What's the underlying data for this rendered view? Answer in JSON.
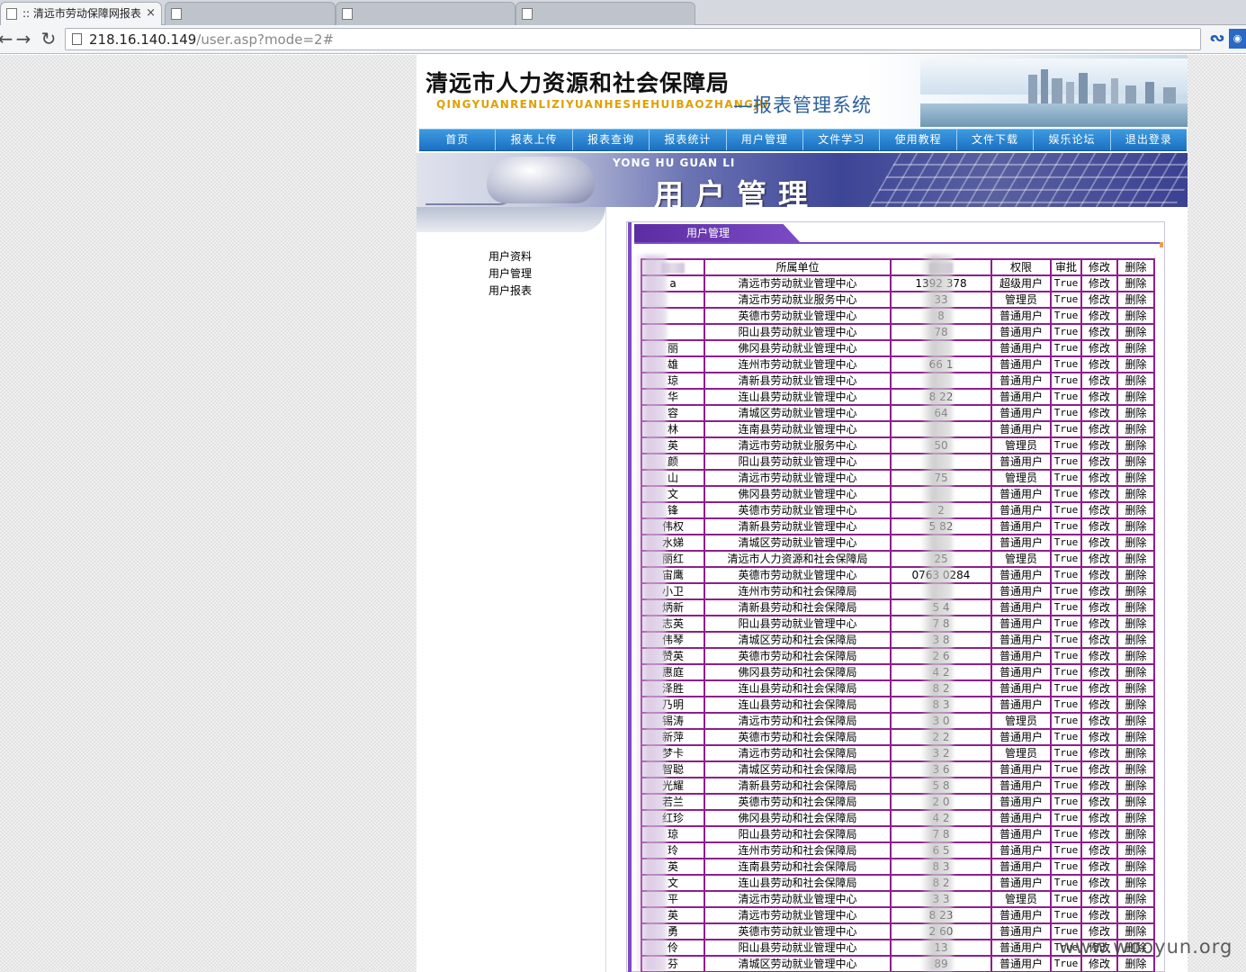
{
  "browser": {
    "tabs": [
      {
        "label": ":: 清远市劳动保障网报表"
      },
      {
        "label": ""
      },
      {
        "label": ""
      },
      {
        "label": ""
      }
    ],
    "url_host": "218.16.140.149",
    "url_path": "/user.asp?mode=2#"
  },
  "site": {
    "title": "清远市人力资源和社会保障局",
    "pinyin": "QINGYUANRENLIZIYUANHESHEHUIBAOZHANGJU",
    "subtitle": "—报表管理系统",
    "nav": [
      "首页",
      "报表上传",
      "报表查询",
      "报表统计",
      "用户管理",
      "文件学习",
      "使用教程",
      "文件下载",
      "娱乐论坛",
      "退出登录"
    ],
    "banner_pinyin": "YONG HU GUAN LI",
    "banner_title": "用户管理"
  },
  "sidebar": {
    "items": [
      "用户资料",
      "用户管理",
      "用户报表"
    ]
  },
  "panel": {
    "tab_label": "用户管理"
  },
  "table": {
    "headers": [
      "",
      "所属单位",
      "",
      "权限",
      "审批",
      "修改",
      "删除"
    ],
    "rows": [
      [
        "a",
        "清远市劳动就业管理中心",
        "1392 378",
        "超级用户",
        "True",
        "修改",
        "删除"
      ],
      [
        "",
        "清远市劳动就业服务中心",
        "33",
        "管理员",
        "True",
        "修改",
        "删除"
      ],
      [
        "",
        "英德市劳动就业管理中心",
        "8",
        "普通用户",
        "True",
        "修改",
        "删除"
      ],
      [
        "",
        "阳山县劳动就业管理中心",
        "78",
        "普通用户",
        "True",
        "修改",
        "删除"
      ],
      [
        "丽",
        "佛冈县劳动就业管理中心",
        "",
        "普通用户",
        "True",
        "修改",
        "删除"
      ],
      [
        "雄",
        "连州市劳动就业管理中心",
        "66 1",
        "普通用户",
        "True",
        "修改",
        "删除"
      ],
      [
        "琼",
        "清新县劳动就业管理中心",
        "",
        "普通用户",
        "True",
        "修改",
        "删除"
      ],
      [
        "华",
        "连山县劳动就业管理中心",
        "8 22",
        "普通用户",
        "True",
        "修改",
        "删除"
      ],
      [
        "容",
        "清城区劳动就业管理中心",
        "64",
        "普通用户",
        "True",
        "修改",
        "删除"
      ],
      [
        "林",
        "连南县劳动就业管理中心",
        "",
        "普通用户",
        "True",
        "修改",
        "删除"
      ],
      [
        "英",
        "清远市劳动就业服务中心",
        "50",
        "管理员",
        "True",
        "修改",
        "删除"
      ],
      [
        "颜",
        "阳山县劳动就业管理中心",
        "",
        "普通用户",
        "True",
        "修改",
        "删除"
      ],
      [
        "山",
        "清远市劳动就业管理中心",
        "75",
        "管理员",
        "True",
        "修改",
        "删除"
      ],
      [
        "文",
        "佛冈县劳动就业管理中心",
        "",
        "普通用户",
        "True",
        "修改",
        "删除"
      ],
      [
        "锋",
        "英德市劳动就业管理中心",
        "2",
        "普通用户",
        "True",
        "修改",
        "删除"
      ],
      [
        "伟权",
        "清新县劳动就业管理中心",
        "5 82",
        "普通用户",
        "True",
        "修改",
        "删除"
      ],
      [
        "水娣",
        "清城区劳动就业管理中心",
        "",
        "普通用户",
        "True",
        "修改",
        "删除"
      ],
      [
        "丽红",
        "清远市人力资源和社会保障局",
        "25",
        "管理员",
        "True",
        "修改",
        "删除"
      ],
      [
        "宙鹰",
        "英德市劳动就业管理中心",
        "0763 0284",
        "普通用户",
        "True",
        "修改",
        "删除"
      ],
      [
        "小卫",
        "连州市劳动和社会保障局",
        "",
        "普通用户",
        "True",
        "修改",
        "删除"
      ],
      [
        "炳新",
        "清新县劳动和社会保障局",
        "5 4",
        "普通用户",
        "True",
        "修改",
        "删除"
      ],
      [
        "志英",
        "阳山县劳动就业管理中心",
        "7 8",
        "普通用户",
        "True",
        "修改",
        "删除"
      ],
      [
        "伟琴",
        "清城区劳动和社会保障局",
        "3 8",
        "普通用户",
        "True",
        "修改",
        "删除"
      ],
      [
        "赞英",
        "英德市劳动和社会保障局",
        "2 6",
        "普通用户",
        "True",
        "修改",
        "删除"
      ],
      [
        "惠庭",
        "佛冈县劳动和社会保障局",
        "4 2",
        "普通用户",
        "True",
        "修改",
        "删除"
      ],
      [
        "泽胜",
        "连山县劳动和社会保障局",
        "8 2",
        "普通用户",
        "True",
        "修改",
        "删除"
      ],
      [
        "乃明",
        "连山县劳动和社会保障局",
        "8 3",
        "普通用户",
        "True",
        "修改",
        "删除"
      ],
      [
        "锡涛",
        "清远市劳动和社会保障局",
        "3 0",
        "管理员",
        "True",
        "修改",
        "删除"
      ],
      [
        "新萍",
        "英德市劳动和社会保障局",
        "2 2",
        "普通用户",
        "True",
        "修改",
        "删除"
      ],
      [
        "梦卡",
        "清远市劳动和社会保障局",
        "3 2",
        "管理员",
        "True",
        "修改",
        "删除"
      ],
      [
        "智聪",
        "清城区劳动和社会保障局",
        "3 6",
        "普通用户",
        "True",
        "修改",
        "删除"
      ],
      [
        "光耀",
        "清新县劳动和社会保障局",
        "5 8",
        "普通用户",
        "True",
        "修改",
        "删除"
      ],
      [
        "若兰",
        "英德市劳动和社会保障局",
        "2 0",
        "普通用户",
        "True",
        "修改",
        "删除"
      ],
      [
        "红珍",
        "佛冈县劳动和社会保障局",
        "4 2",
        "普通用户",
        "True",
        "修改",
        "删除"
      ],
      [
        "琼",
        "阳山县劳动和社会保障局",
        "7 8",
        "普通用户",
        "True",
        "修改",
        "删除"
      ],
      [
        "玲",
        "连州市劳动和社会保障局",
        "6 5",
        "普通用户",
        "True",
        "修改",
        "删除"
      ],
      [
        "英",
        "连南县劳动和社会保障局",
        "8 3",
        "普通用户",
        "True",
        "修改",
        "删除"
      ],
      [
        "文",
        "连山县劳动和社会保障局",
        "8 2",
        "普通用户",
        "True",
        "修改",
        "删除"
      ],
      [
        "平",
        "清远市劳动就业管理中心",
        "3 3",
        "管理员",
        "True",
        "修改",
        "删除"
      ],
      [
        "英",
        "清远市劳动就业管理中心",
        "8 23",
        "普通用户",
        "True",
        "修改",
        "删除"
      ],
      [
        "勇",
        "英德市劳动就业管理中心",
        "2 60",
        "普通用户",
        "True",
        "修改",
        "删除"
      ],
      [
        "伶",
        "阳山县劳动就业管理中心",
        "13",
        "普通用户",
        "True",
        "修改",
        "删除"
      ],
      [
        "芬",
        "清城区劳动就业管理中心",
        "89",
        "普通用户",
        "True",
        "修改",
        "删除"
      ]
    ]
  },
  "watermark": "www.wooyun.org",
  "colors": {
    "nav": "#1b6fc2",
    "table_border": "#8e1f8c",
    "panel_tab": "#5b2da3"
  }
}
